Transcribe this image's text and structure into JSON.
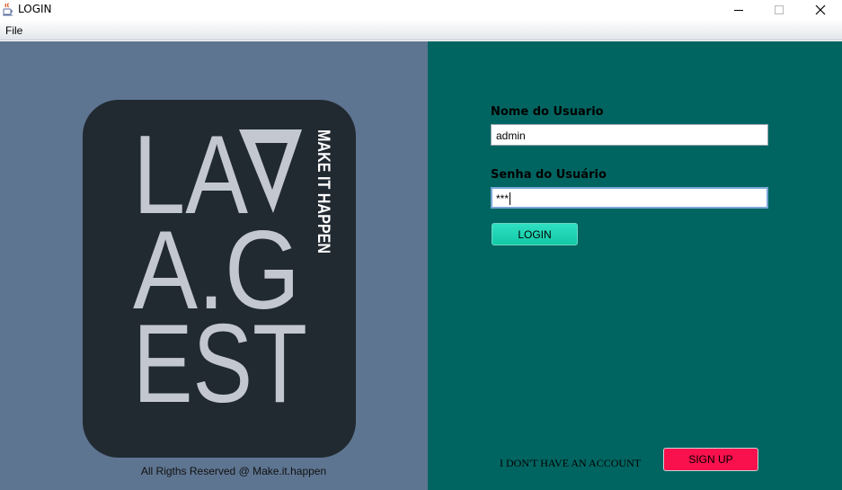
{
  "window": {
    "title": "LOGIN",
    "app_icon": "java-coffee-icon",
    "controls": [
      "minimize-icon",
      "maximize-icon",
      "close-icon"
    ]
  },
  "menu": {
    "items": [
      {
        "label": "File"
      }
    ]
  },
  "left_panel": {
    "background": "#5e7591",
    "logo": {
      "lines": [
        "LA",
        "A.G",
        "EST"
      ],
      "tagline": "MAKE IT HAPPEN",
      "card_color": "#212931",
      "letter_color": "#c3c8d0"
    },
    "copyright": "All Rigths Reserved @ Make.it.happen"
  },
  "login_form": {
    "background": "#006561",
    "username_label": "Nome do Usuario",
    "username_value": "admin",
    "password_label": "Senha do Usuário",
    "password_value": "***",
    "login_button": "LOGIN",
    "login_button_color": "#1fd6b4"
  },
  "signup": {
    "prompt": "I DON'T HAVE AN ACCOUNT",
    "button": "SIGN UP",
    "button_color": "#f8114c"
  }
}
